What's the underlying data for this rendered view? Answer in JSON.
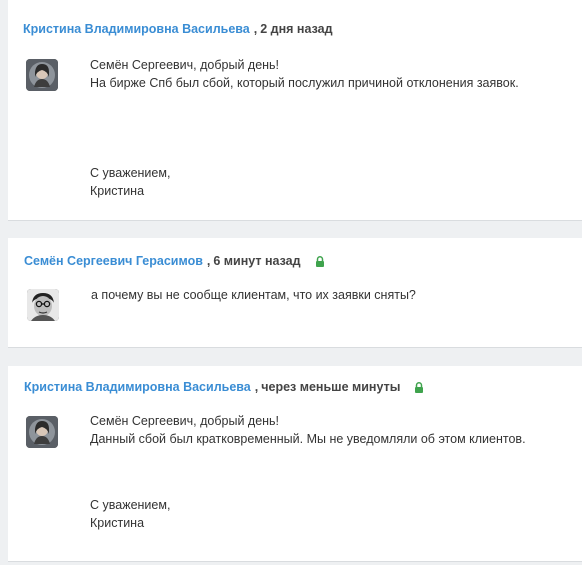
{
  "messages": [
    {
      "author": "Кристина Владимировна Васильева",
      "separator": ",",
      "time": "2 дня назад",
      "locked": false,
      "avatar_icon": "user-avatar-female",
      "greeting": "Семён Сергеевич, добрый день!",
      "text": "На бирже Спб был сбой, который послужил причиной отклонения заявок.",
      "signoff": "С уважением,",
      "signature": "Кристина"
    },
    {
      "author": "Семён Сергеевич Герасимов",
      "separator": ",",
      "time": "6 минут назад",
      "locked": true,
      "avatar_icon": "user-avatar-male",
      "text": "а почему вы не сообще клиентам, что их заявки сняты?"
    },
    {
      "author": "Кристина Владимировна Васильева",
      "separator": ",",
      "time": "через меньше минуты",
      "locked": true,
      "avatar_icon": "user-avatar-female",
      "greeting": "Семён Сергеевич, добрый день!",
      "text": "Данный сбой был кратковременный. Мы не уведомляли об этом клиентов.",
      "signoff": "С уважением,",
      "signature": "Кристина"
    }
  ],
  "colors": {
    "author_link": "#3a8dd4",
    "lock_green": "#3fa34d",
    "background": "#eef0f2",
    "card": "#ffffff"
  }
}
